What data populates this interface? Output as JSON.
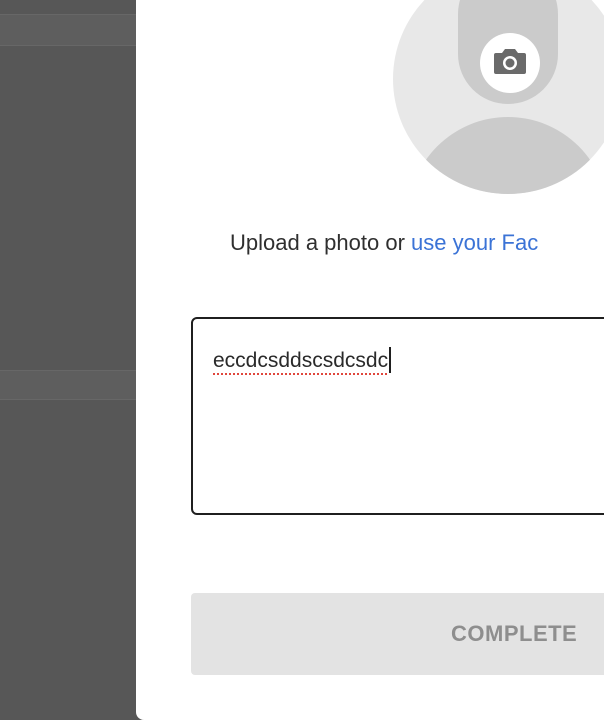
{
  "upload": {
    "prefix": "Upload a photo or ",
    "link": "use your Fac"
  },
  "bio": {
    "value": "eccdcsddscsdcsdc"
  },
  "actions": {
    "complete_label": "COMPLETE"
  },
  "icons": {
    "avatar": "default-user-avatar",
    "camera": "camera-icon"
  },
  "colors": {
    "link": "#3b73d6",
    "overlay": "#575757",
    "button_disabled_bg": "#e3e3e3",
    "button_disabled_text": "#8e8e8e",
    "spellcheck_underline": "#e0463c"
  }
}
